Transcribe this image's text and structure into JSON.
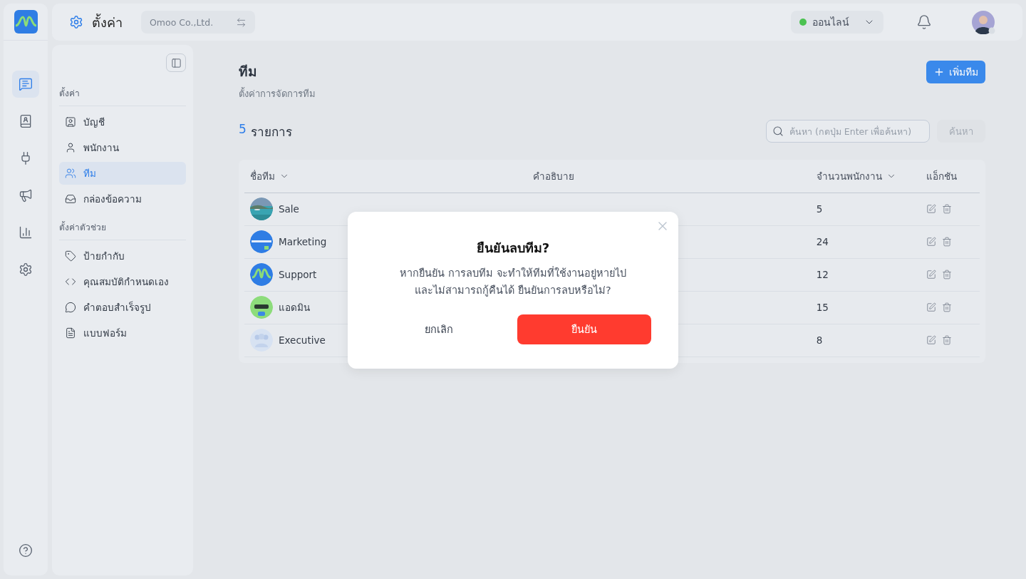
{
  "header": {
    "page_title": "ตั้งค่า",
    "company": "Omoo Co.,Ltd.",
    "status": "ออนไลน์"
  },
  "rail": [
    {
      "kind": "chat",
      "selected": true
    },
    {
      "kind": "contacts",
      "selected": false
    },
    {
      "kind": "plug",
      "selected": false
    },
    {
      "kind": "megaphone",
      "selected": false
    },
    {
      "kind": "chart",
      "selected": false
    },
    {
      "kind": "settings",
      "selected": false
    }
  ],
  "sidebar": {
    "sections": [
      {
        "title": "ตั้งค่า",
        "items": [
          {
            "label": "บัญชี",
            "kind": "account",
            "selected": false
          },
          {
            "label": "พนักงาน",
            "kind": "user",
            "selected": false
          },
          {
            "label": "ทีม",
            "kind": "team",
            "selected": true
          },
          {
            "label": "กล่องข้อความ",
            "kind": "inbox",
            "selected": false
          }
        ]
      },
      {
        "title": "ตั้งค่าตัวช่วย",
        "items": [
          {
            "label": "ป้ายกำกับ",
            "kind": "tag",
            "selected": false
          },
          {
            "label": "คุณสมบัติกำหนดเอง",
            "kind": "code",
            "selected": false
          },
          {
            "label": "คำตอบสำเร็จรูป",
            "kind": "reply",
            "selected": false
          },
          {
            "label": "แบบฟอร์ม",
            "kind": "form",
            "selected": false
          }
        ]
      }
    ]
  },
  "page": {
    "title": "ทีม",
    "subtitle": "ตั้งค่าการจัดการทีม",
    "add_button": "เพิ่มทีม"
  },
  "count": {
    "number": "5",
    "label": "รายการ"
  },
  "search": {
    "placeholder": "ค้นหา (กดปุ่ม Enter เพื่อค้นหา)",
    "button": "ค้นหา",
    "disabled": true
  },
  "table": {
    "columns": [
      {
        "label": "ชื่อทีม",
        "sortable": true
      },
      {
        "label": "คำอธิบาย",
        "sortable": false
      },
      {
        "label": "จำนวนพนักงาน",
        "sortable": true
      },
      {
        "label": "แอ็กชัน",
        "sortable": false
      }
    ],
    "rows": [
      {
        "name": "Sale",
        "members": "5"
      },
      {
        "name": "Marketing",
        "members": "24",
        "kind": "mkt"
      },
      {
        "name": "Support",
        "members": "12",
        "kind": "logo"
      },
      {
        "name": "แอดมิน",
        "members": "15",
        "kind": "admin"
      },
      {
        "name": "Executive",
        "members": "8",
        "kind": "group"
      }
    ]
  },
  "dialog": {
    "title": "ยืนยันลบทีม?",
    "message": "หากยืนยัน การลบทีม จะทำให้ทีมที่ใช้งานอยู่หายไป และไม่สามารถกู้คืนได้ ยืนยันการลบหรือไม่?",
    "cancel": "ยกเลิก",
    "confirm": "ยืนยัน"
  }
}
